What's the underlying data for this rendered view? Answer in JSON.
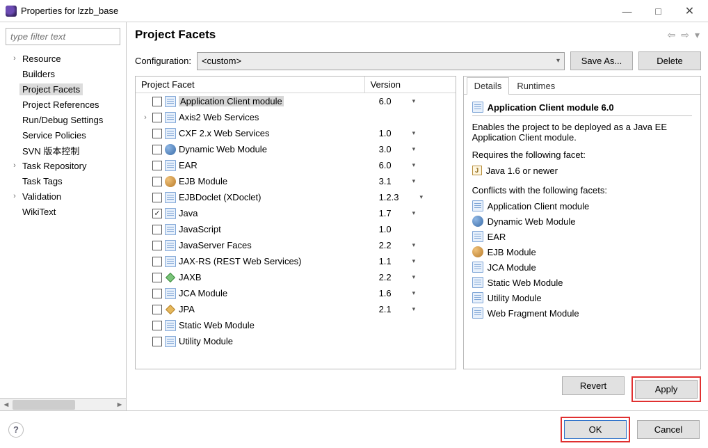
{
  "window": {
    "title": "Properties for lzzb_base",
    "min": "—",
    "max": "□",
    "close": "✕"
  },
  "sidebar": {
    "filter_placeholder": "type filter text",
    "items": [
      {
        "label": "Resource",
        "expandable": true
      },
      {
        "label": "Builders",
        "expandable": false
      },
      {
        "label": "Project Facets",
        "expandable": false,
        "selected": true
      },
      {
        "label": "Project References",
        "expandable": false
      },
      {
        "label": "Run/Debug Settings",
        "expandable": false
      },
      {
        "label": "Service Policies",
        "expandable": false
      },
      {
        "label": "SVN 版本控制",
        "expandable": false
      },
      {
        "label": "Task Repository",
        "expandable": true
      },
      {
        "label": "Task Tags",
        "expandable": false
      },
      {
        "label": "Validation",
        "expandable": true
      },
      {
        "label": "WikiText",
        "expandable": false
      }
    ]
  },
  "page": {
    "title": "Project Facets",
    "config_label": "Configuration:",
    "config_value": "<custom>",
    "save_as": "Save As...",
    "delete": "Delete",
    "col_facet": "Project Facet",
    "col_version": "Version",
    "revert": "Revert",
    "apply": "Apply"
  },
  "facets": [
    {
      "name": "Application Client module",
      "version": "6.0",
      "icon": "doc",
      "checked": false,
      "selected": true,
      "caret": true
    },
    {
      "name": "Axis2 Web Services",
      "version": "",
      "icon": "doc",
      "checked": false,
      "expandable": true,
      "caret": false
    },
    {
      "name": "CXF 2.x Web Services",
      "version": "1.0",
      "icon": "doc",
      "checked": false,
      "caret": true
    },
    {
      "name": "Dynamic Web Module",
      "version": "3.0",
      "icon": "dyn",
      "checked": false,
      "caret": true
    },
    {
      "name": "EAR",
      "version": "6.0",
      "icon": "doc",
      "checked": false,
      "caret": true
    },
    {
      "name": "EJB Module",
      "version": "3.1",
      "icon": "ejb",
      "checked": false,
      "caret": true
    },
    {
      "name": "EJBDoclet (XDoclet)",
      "version": "1.2.3",
      "icon": "doc",
      "checked": false,
      "caret": true
    },
    {
      "name": "Java",
      "version": "1.7",
      "icon": "doc",
      "checked": true,
      "caret": true
    },
    {
      "name": "JavaScript",
      "version": "1.0",
      "icon": "doc",
      "checked": false,
      "caret": false
    },
    {
      "name": "JavaServer Faces",
      "version": "2.2",
      "icon": "doc",
      "checked": false,
      "caret": true
    },
    {
      "name": "JAX-RS (REST Web Services)",
      "version": "1.1",
      "icon": "doc",
      "checked": false,
      "caret": true
    },
    {
      "name": "JAXB",
      "version": "2.2",
      "icon": "diamond-green",
      "checked": false,
      "caret": true
    },
    {
      "name": "JCA Module",
      "version": "1.6",
      "icon": "doc",
      "checked": false,
      "caret": true
    },
    {
      "name": "JPA",
      "version": "2.1",
      "icon": "diamond-orange",
      "checked": false,
      "caret": true
    },
    {
      "name": "Static Web Module",
      "version": "",
      "icon": "doc",
      "checked": false,
      "caret": false
    },
    {
      "name": "Utility Module",
      "version": "",
      "icon": "doc",
      "checked": false,
      "caret": false
    }
  ],
  "details": {
    "tab_details": "Details",
    "tab_runtimes": "Runtimes",
    "title": "Application Client module 6.0",
    "desc": "Enables the project to be deployed as a Java EE Application Client module.",
    "requires_label": "Requires the following facet:",
    "requires": [
      {
        "label": "Java 1.6 or newer",
        "icon": "java"
      }
    ],
    "conflicts_label": "Conflicts with the following facets:",
    "conflicts": [
      {
        "label": "Application Client module",
        "icon": "doc"
      },
      {
        "label": "Dynamic Web Module",
        "icon": "dyn"
      },
      {
        "label": "EAR",
        "icon": "doc"
      },
      {
        "label": "EJB Module",
        "icon": "ejb"
      },
      {
        "label": "JCA Module",
        "icon": "doc"
      },
      {
        "label": "Static Web Module",
        "icon": "doc"
      },
      {
        "label": "Utility Module",
        "icon": "doc"
      },
      {
        "label": "Web Fragment Module",
        "icon": "doc"
      }
    ]
  },
  "footer": {
    "ok": "OK",
    "cancel": "Cancel"
  }
}
